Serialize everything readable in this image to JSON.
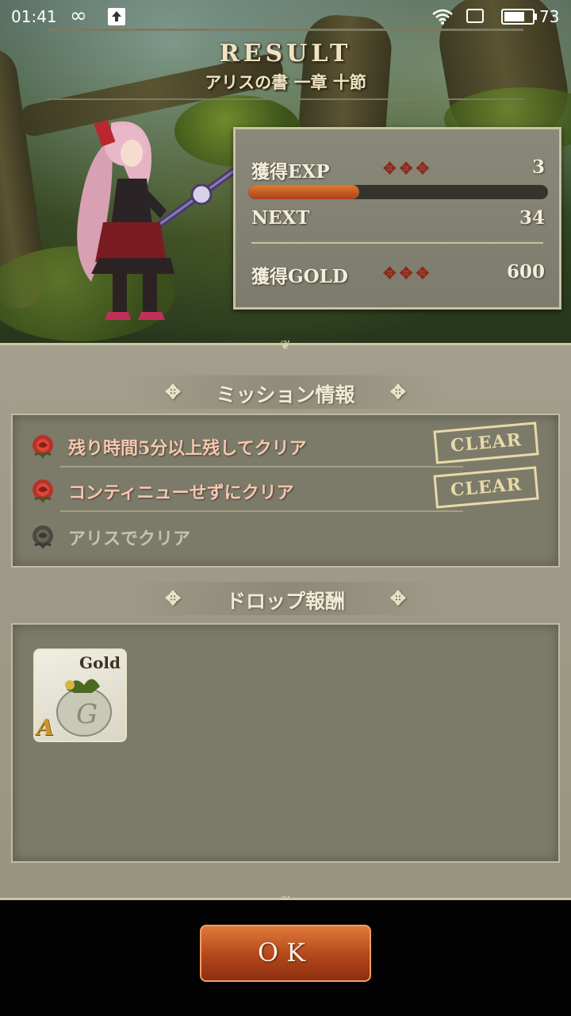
{
  "status_bar": {
    "time": "01:41",
    "infinity_icon": "infinity-icon",
    "upload_icon": "upload-icon",
    "wifi_icon": "wifi-icon",
    "sim_icon": "sim-icon",
    "battery_icon": "battery-icon",
    "battery_level": "73",
    "battery_fraction": 0.73
  },
  "header": {
    "title": "RESULT",
    "subtitle": "アリスの書 一章 十節"
  },
  "stats": {
    "exp_label": "獲得EXP",
    "exp_value": "3",
    "exp_progress": 0.37,
    "next_label": "NEXT",
    "next_value": "34",
    "gold_label": "獲得GOLD",
    "gold_value": "600",
    "ornament": "✥✥✥"
  },
  "missions": {
    "title": "ミッション情報",
    "items": [
      {
        "text": "残り時間5分以上残してクリア",
        "cleared": true,
        "stamp": "CLEAR"
      },
      {
        "text": "コンティニューせずにクリア",
        "cleared": true,
        "stamp": "CLEAR"
      },
      {
        "text": "アリスでクリア",
        "cleared": false
      }
    ]
  },
  "drops": {
    "title": "ドロップ報酬",
    "items": [
      {
        "label": "Gold",
        "rank": "A",
        "icon": "gold-bag-icon"
      }
    ]
  },
  "ok_button": {
    "label": "OK"
  },
  "colors": {
    "exp_fill": "#d56a2a",
    "rose_active": "#b8322a",
    "rose_inactive": "#4a4a42",
    "ok_button": "#b64a1c"
  }
}
